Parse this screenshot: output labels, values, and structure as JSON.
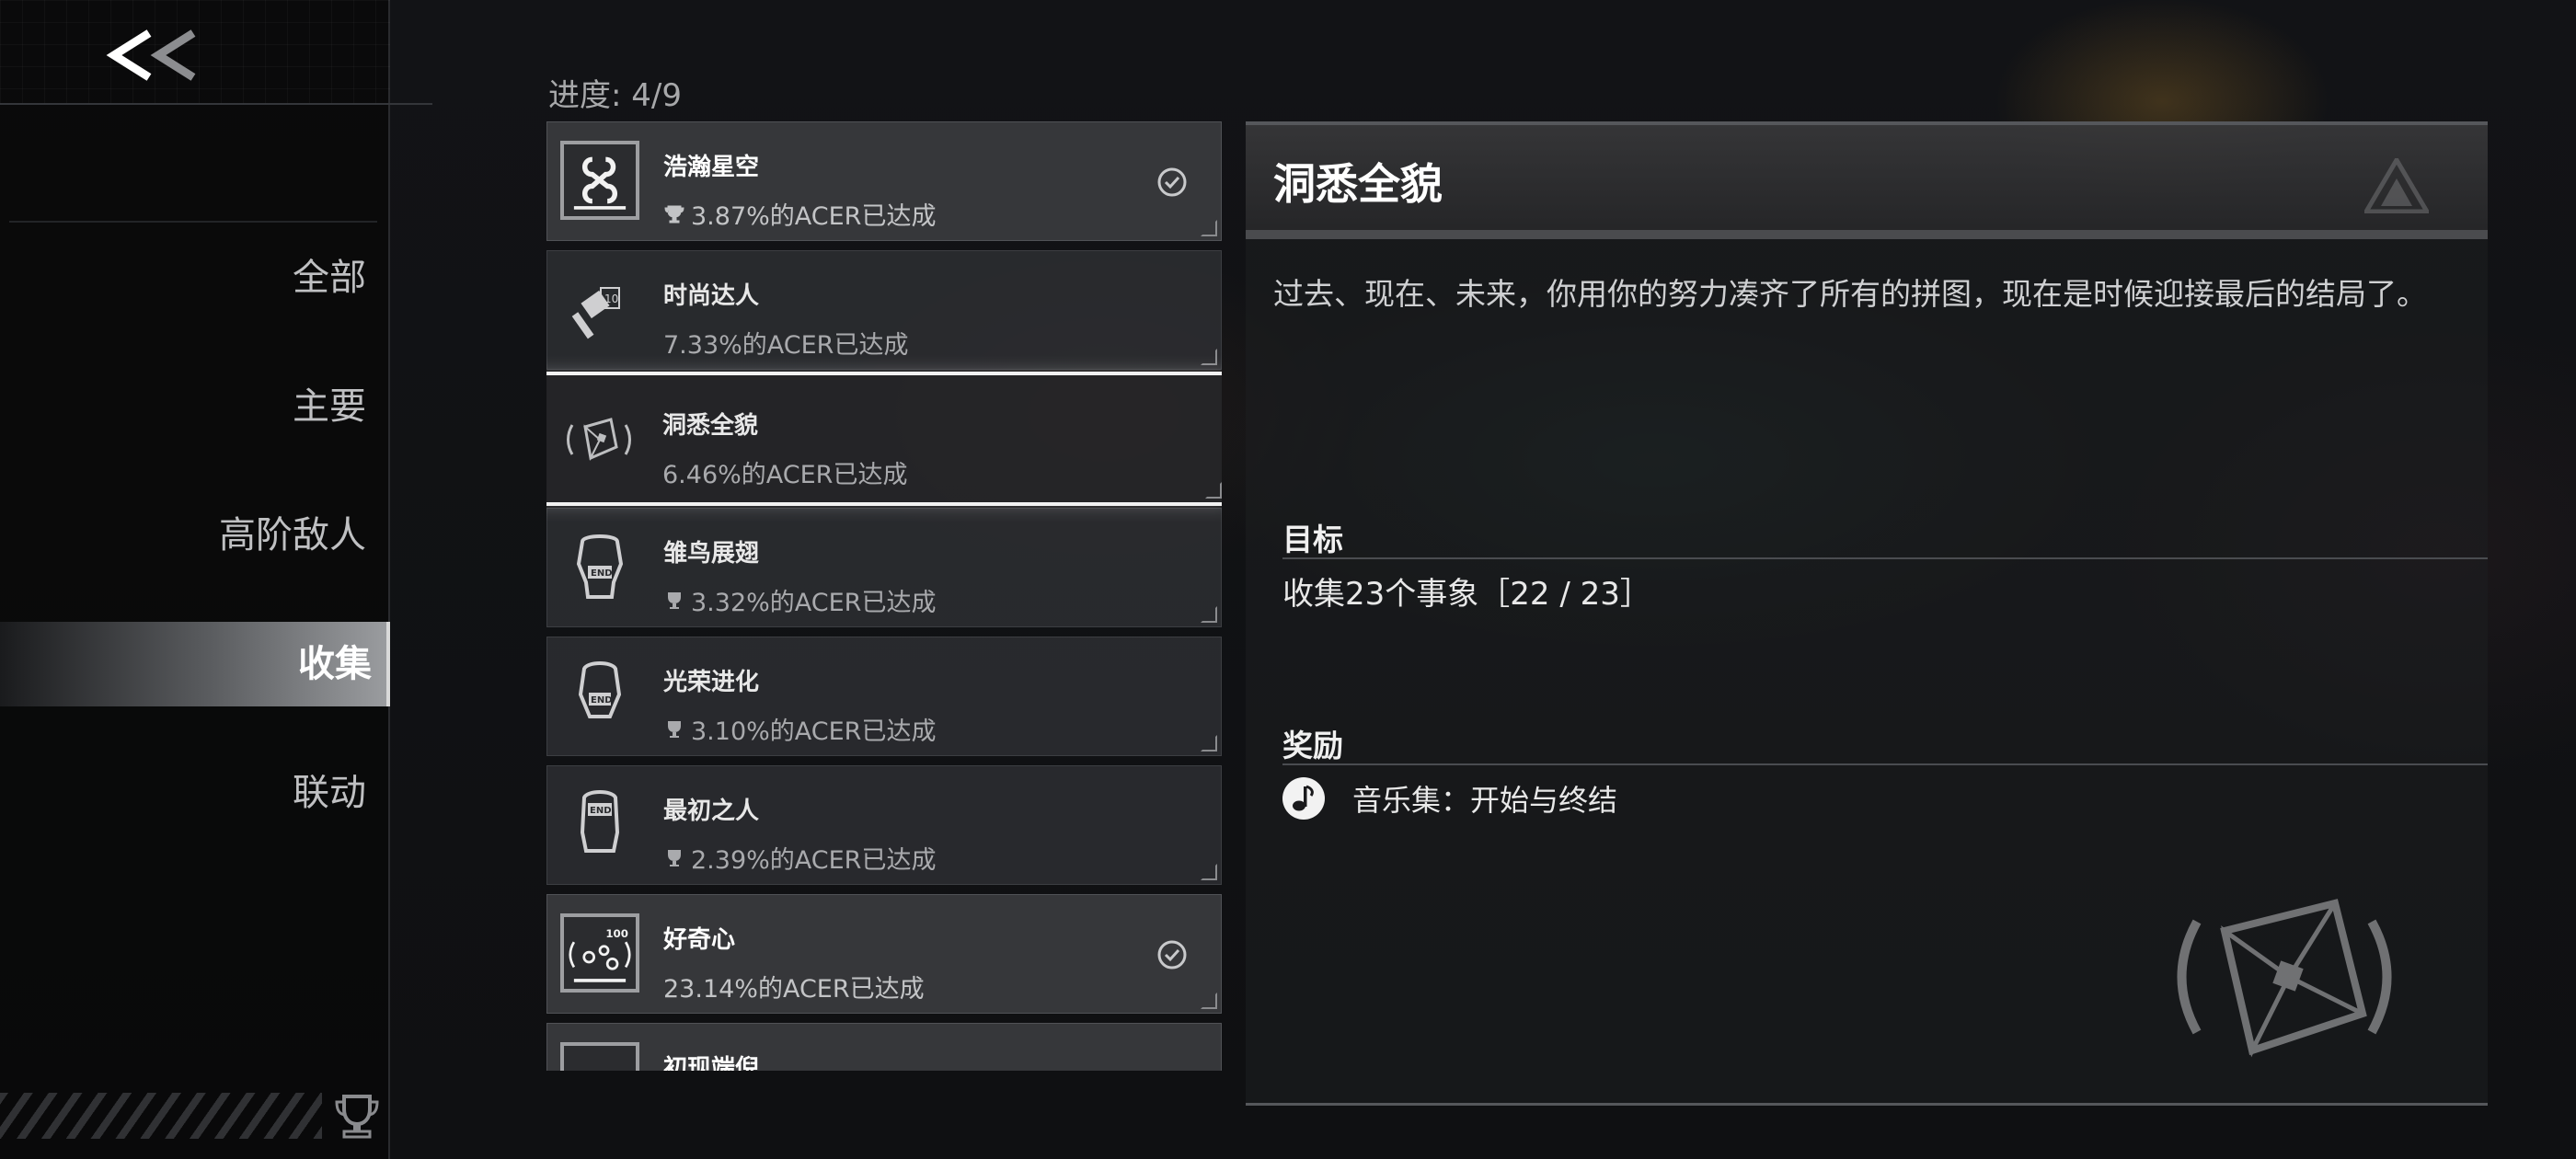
{
  "sidebar": {
    "back_label": "<<",
    "items": [
      {
        "label": "全部",
        "active": false
      },
      {
        "label": "主要",
        "active": false
      },
      {
        "label": "高阶敌人",
        "active": false
      },
      {
        "label": "收集",
        "active": true
      },
      {
        "label": "联动",
        "active": false
      }
    ]
  },
  "progress": {
    "label": "进度:",
    "value": "4/9"
  },
  "achievements": [
    {
      "name": "浩瀚星空",
      "rate": "3.87%的ACER已达成",
      "completed": true,
      "trophy": true,
      "icon": "chain-link-icon"
    },
    {
      "name": "时尚达人",
      "rate": "7.33%的ACER已达成",
      "completed": false,
      "trophy": false,
      "icon": "hammer-icon"
    },
    {
      "name": "洞悉全貌",
      "rate": "6.46%的ACER已达成",
      "completed": false,
      "trophy": false,
      "selected": true,
      "icon": "puzzle-frame-icon"
    },
    {
      "name": "雏鸟展翅",
      "rate": "3.32%的ACER已达成",
      "completed": false,
      "trophy": true,
      "icon": "character-end-icon"
    },
    {
      "name": "光荣进化",
      "rate": "3.10%的ACER已达成",
      "completed": false,
      "trophy": true,
      "icon": "character-end-icon"
    },
    {
      "name": "最初之人",
      "rate": "2.39%的ACER已达成",
      "completed": false,
      "trophy": true,
      "icon": "character-end-icon"
    },
    {
      "name": "好奇心",
      "rate": "23.14%的ACER已达成",
      "completed": true,
      "trophy": false,
      "icon": "curiosity-100-icon"
    },
    {
      "name": "初现端倪",
      "rate": "",
      "completed": true,
      "trophy": false,
      "icon": "unknown-icon"
    }
  ],
  "detail": {
    "title": "洞悉全貌",
    "description": "过去、现在、未来，你用你的努力凑齐了所有的拼图，现在是时候迎接最后的结局了。",
    "goal_heading": "目标",
    "goal_text": "收集23个事象［22 / 23］",
    "reward_heading": "奖励",
    "reward_text": "音乐集：开始与终结",
    "reward_icon": "music-note-icon"
  },
  "colors": {
    "accent_active": "#9a9c9f",
    "selected_border": "#f2f2f2",
    "background": "#0d0e10"
  }
}
